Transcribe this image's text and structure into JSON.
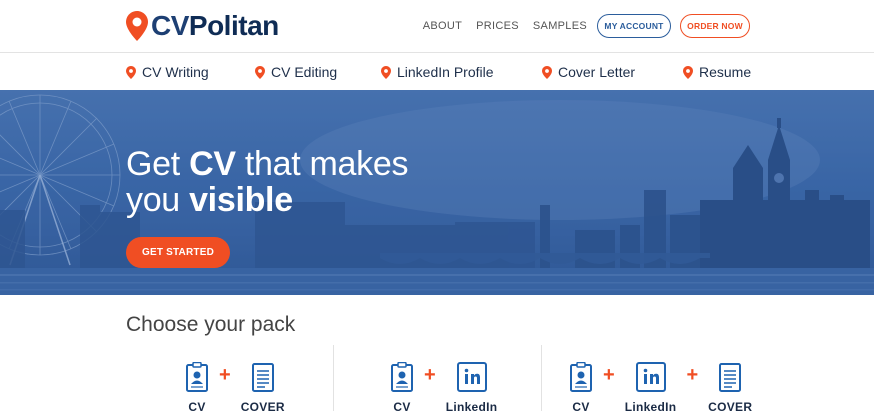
{
  "brand": {
    "name_part1": "CV",
    "name_part2": "Politan",
    "accent": "#f04e23",
    "primary": "#1d3f73"
  },
  "topnav": {
    "links": [
      "ABOUT",
      "PRICES",
      "SAMPLES"
    ],
    "my_account": "MY ACCOUNT",
    "order_now": "ORDER NOW"
  },
  "services": [
    "CV Writing",
    "CV Editing",
    "LinkedIn Profile",
    "Cover Letter",
    "Resume"
  ],
  "hero": {
    "line1_normal": "Get ",
    "line1_bold": "CV",
    "line1_rest": " that makes",
    "line2_normal": "you ",
    "line2_bold": "visible",
    "cta": "GET STARTED"
  },
  "packs": {
    "title": "Choose your pack",
    "pack1": {
      "items": [
        "CV",
        "COVER"
      ]
    },
    "pack2": {
      "items": [
        "CV",
        "LinkedIn"
      ]
    },
    "pack3": {
      "items": [
        "CV",
        "LinkedIn",
        "COVER"
      ]
    }
  }
}
